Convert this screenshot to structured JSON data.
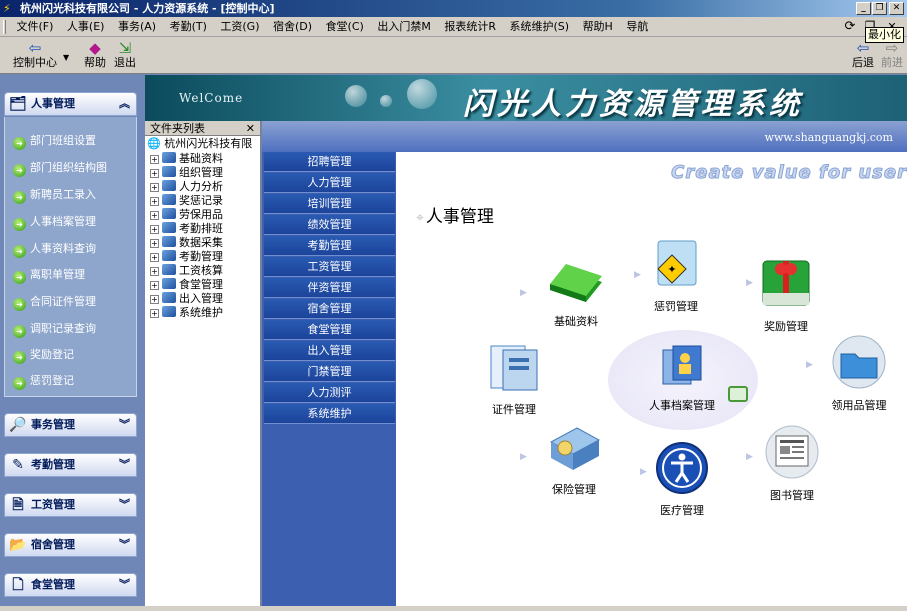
{
  "window": {
    "title": "杭州闪光科技有限公司 - 人力资源系统 - [控制中心]"
  },
  "menu": [
    "文件(F)",
    "人事(E)",
    "事务(A)",
    "考勤(T)",
    "工资(G)",
    "宿舍(D)",
    "食堂(C)",
    "出入门禁M",
    "报表统计R",
    "系统维护(S)",
    "帮助H",
    "导航"
  ],
  "toolbar": {
    "control_center": "控制中心",
    "help": "帮助",
    "exit": "退出",
    "back": "后退",
    "forward": "前进",
    "tooltip": "最小化"
  },
  "sidebar": {
    "active_panel": "人事管理",
    "items": [
      "部门班组设置",
      "部门组织结构图",
      "新聘员工录入",
      "人事档案管理",
      "人事资料查询",
      "离职单管理",
      "合同证件管理",
      "调职记录查询",
      "奖励登记",
      "惩罚登记"
    ],
    "collapsed_panels": [
      "事务管理",
      "考勤管理",
      "工资管理",
      "宿舍管理",
      "食堂管理"
    ]
  },
  "banner": {
    "welcome": "WelCome",
    "title": "闪光人力资源管理系统"
  },
  "tree": {
    "header": "文件夹列表",
    "root": "杭州闪光科技有限",
    "nodes": [
      "基础资料",
      "组织管理",
      "人力分析",
      "奖惩记录",
      "劳保用品",
      "考勤排班",
      "数据采集",
      "考勤管理",
      "工资核算",
      "食堂管理",
      "出入管理",
      "系统维护"
    ]
  },
  "content": {
    "url": "www.shanguangkj.com",
    "modules": [
      "招聘管理",
      "人力管理",
      "培训管理",
      "绩效管理",
      "考勤管理",
      "工资管理",
      "伴资管理",
      "宿舍管理",
      "食堂管理",
      "出入管理",
      "门禁管理",
      "人力测评",
      "系统维护"
    ],
    "tagline": "Create value for user",
    "page_title": "人事管理",
    "cards": {
      "basic": "基础资料",
      "punish": "惩罚管理",
      "reward": "奖励管理",
      "cert": "证件管理",
      "archive": "人事档案管理",
      "supplies": "领用品管理",
      "insurance": "保险管理",
      "medical": "医疗管理",
      "books": "图书管理"
    }
  }
}
